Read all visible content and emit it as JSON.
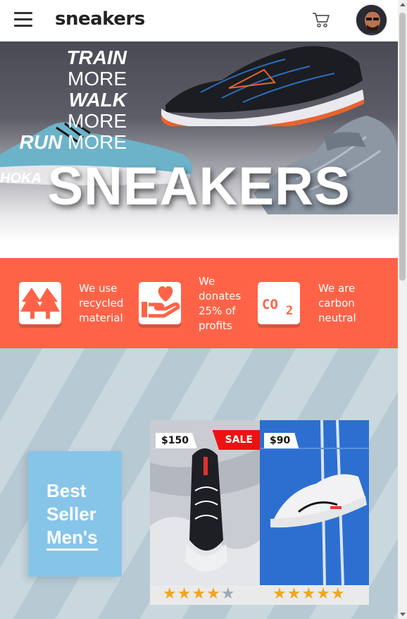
{
  "header": {
    "brand": "sneakers",
    "menu_icon": "hamburger-menu-icon",
    "cart_icon": "cart-icon",
    "avatar_icon": "user-avatar"
  },
  "hero": {
    "tagline": [
      {
        "bold": "TRAIN",
        "light": "MORE"
      },
      {
        "bold": "WALK",
        "light": "MORE"
      },
      {
        "bold": "RUN",
        "light": "MORE"
      }
    ],
    "title": "SNEAKERS",
    "shoe_brand": "HOKA"
  },
  "values": [
    {
      "icon": "trees-icon",
      "line1": "We use",
      "line2": "recycled",
      "line3": "material"
    },
    {
      "icon": "heart-hand-icon",
      "line1": "We",
      "line2": "donates",
      "line3": "25% of",
      "line4": "profits"
    },
    {
      "icon": "co2-icon",
      "icon_text": "CO2",
      "line1": "We are",
      "line2": "carbon",
      "line3": "neutral"
    }
  ],
  "best_seller": {
    "line1": "Best",
    "line2": "Seller",
    "line3": "Men's"
  },
  "products": [
    {
      "price": "$150",
      "badge": "SALE",
      "rating": 4.5
    },
    {
      "price": "$90",
      "rating": 5
    }
  ],
  "colors": {
    "accent": "#fe6348",
    "best_box": "#86c5e8",
    "star": "#f3a51c",
    "sale": "#ee1111"
  }
}
